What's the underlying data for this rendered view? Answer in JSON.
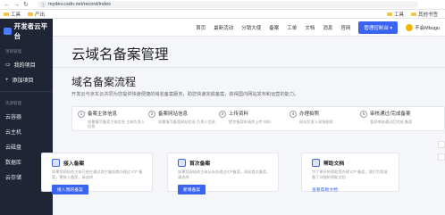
{
  "browser": {
    "back": "←",
    "forward": "→",
    "reload": "↻",
    "url": "mydev.csdn.net/record/index",
    "lock": "ⓘ"
  },
  "bookmarks": [
    {
      "label": "工具"
    },
    {
      "label": "产出"
    }
  ],
  "bookmarks_right": [
    {
      "label": "工具"
    },
    {
      "label": "其他书签"
    }
  ],
  "sidebar": {
    "brand": "开发者云平台",
    "groups": [
      {
        "label": "项目管理"
      },
      {
        "label": "资源管理"
      }
    ],
    "items_top": [
      {
        "label": "我的项目"
      },
      {
        "label": "添加项目"
      }
    ],
    "items_bottom": [
      {
        "label": "云容器"
      },
      {
        "label": "云主机"
      },
      {
        "label": "云磁盘"
      },
      {
        "label": "数据库"
      },
      {
        "label": "云存储"
      }
    ]
  },
  "topnav": {
    "items": [
      "首页",
      "最新活动",
      "分销大使",
      "备案",
      "工单",
      "文档",
      "消息",
      "官网"
    ],
    "console": "管理控制台",
    "user": "不会Mbugu"
  },
  "page": {
    "title": "云域名备案管理",
    "section": "域名备案流程",
    "desc": "开发云与京东云共同为您提供快速便捷的域名备案服务，助您快速完成备案，获得国内网站发布和运营的能力。"
  },
  "steps": [
    {
      "num": "1",
      "title": "备案主体信息",
      "sub": "如需填写备案主体信息\n主体负责人信息"
    },
    {
      "num": "2",
      "title": "备案网站信息",
      "sub": "如需填写备案网站信息\n负责人信息"
    },
    {
      "num": "3",
      "title": "上传资料",
      "sub": "提交备案申请并上传\n材料"
    },
    {
      "num": "4",
      "title": "办理拍照",
      "sub": "网站负责人现场拍照"
    },
    {
      "num": "5",
      "title": "审核通过/完成备案",
      "sub": "管局审核通过后完成\n备案"
    }
  ],
  "cards": {
    "first": {
      "title": "接入备案",
      "text": "如果您网站的主体已经在通过其它服务商办理过 ICP 备案，需接入备案，请选择",
      "button": "接入我的备案"
    },
    "second": {
      "title": "首次备案",
      "text": "如果您网站的主体从未办理过ICP备案，网站首次备案，请选择",
      "button": "新增备案"
    },
    "help": {
      "title": "帮助文档",
      "text": "为了更好的帮助您办理 ICP 备案，我们为您准备了详细的帮助文档",
      "link": "查看帮助文档"
    }
  },
  "colors": {
    "sidebar_bg": "#1f2535",
    "accent": "#3a63f0",
    "page_bg": "#f4f6f9"
  }
}
